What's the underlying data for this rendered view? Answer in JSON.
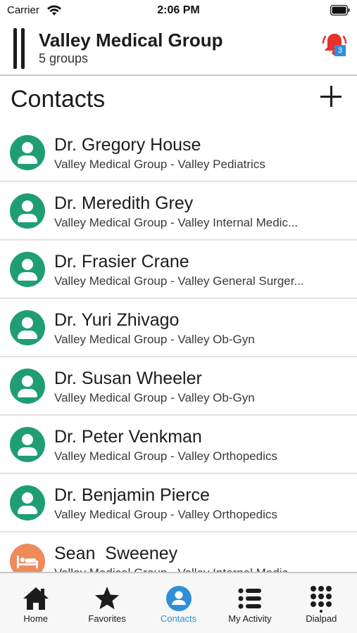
{
  "status_bar": {
    "carrier": "Carrier",
    "time": "2:06 PM"
  },
  "header": {
    "title": "Valley Medical Group",
    "subtitle": "5 groups",
    "notification_count": "3",
    "bell_color": "#e8302c"
  },
  "section": {
    "title": "Contacts"
  },
  "contacts": [
    {
      "name": "Dr. Gregory House",
      "group": "Valley Medical Group - Valley Pediatrics",
      "avatar": "person-icon"
    },
    {
      "name": "Dr. Meredith Grey",
      "group": "Valley Medical Group - Valley Internal Medic...",
      "avatar": "person-icon"
    },
    {
      "name": "Dr. Frasier Crane",
      "group": "Valley Medical Group - Valley General Surger...",
      "avatar": "person-icon"
    },
    {
      "name": "Dr. Yuri Zhivago",
      "group": "Valley Medical Group - Valley Ob-Gyn",
      "avatar": "person-icon"
    },
    {
      "name": "Dr. Susan Wheeler",
      "group": "Valley Medical Group - Valley Ob-Gyn",
      "avatar": "person-icon"
    },
    {
      "name": "Dr. Peter Venkman",
      "group": "Valley Medical Group - Valley Orthopedics",
      "avatar": "person-icon"
    },
    {
      "name": "Dr. Benjamin Pierce",
      "group": "Valley Medical Group - Valley Orthopedics",
      "avatar": "person-icon"
    },
    {
      "name": "Sean  Sweeney",
      "group": "Valley Medical Group - Valley Internal Medic",
      "avatar": "patient-bed-icon"
    }
  ],
  "tabs": [
    {
      "label": "Home",
      "icon": "home-icon",
      "active": false
    },
    {
      "label": "Favorites",
      "icon": "star-icon",
      "active": false
    },
    {
      "label": "Contacts",
      "icon": "contacts-icon",
      "active": true
    },
    {
      "label": "My Activity",
      "icon": "list-icon",
      "active": false
    },
    {
      "label": "Dialpad",
      "icon": "dialpad-icon",
      "active": false
    }
  ],
  "colors": {
    "accent": "#2f8fd6",
    "avatar_green": "#1f9e74",
    "avatar_orange": "#ef8a5b"
  }
}
